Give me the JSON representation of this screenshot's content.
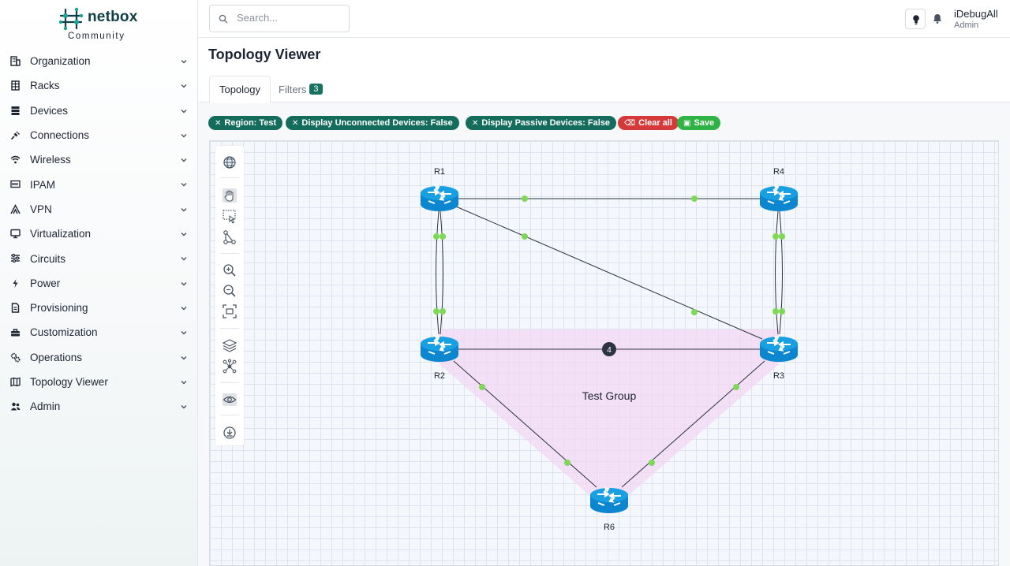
{
  "brand": {
    "name": "netbox",
    "edition": "Community"
  },
  "sidebar": {
    "items": [
      {
        "label": "Organization",
        "icon": "building-icon"
      },
      {
        "label": "Racks",
        "icon": "rack-icon"
      },
      {
        "label": "Devices",
        "icon": "server-icon"
      },
      {
        "label": "Connections",
        "icon": "plug-icon"
      },
      {
        "label": "Wireless",
        "icon": "wifi-icon"
      },
      {
        "label": "IPAM",
        "icon": "counter-icon"
      },
      {
        "label": "VPN",
        "icon": "tunnel-icon"
      },
      {
        "label": "Virtualization",
        "icon": "monitor-icon"
      },
      {
        "label": "Circuits",
        "icon": "circuit-icon"
      },
      {
        "label": "Power",
        "icon": "flash-icon"
      },
      {
        "label": "Provisioning",
        "icon": "file-icon"
      },
      {
        "label": "Customization",
        "icon": "toolbox-icon"
      },
      {
        "label": "Operations",
        "icon": "cogs-icon"
      },
      {
        "label": "Topology Viewer",
        "icon": "map-icon"
      },
      {
        "label": "Admin",
        "icon": "users-icon"
      }
    ]
  },
  "header": {
    "search_placeholder": "Search...",
    "user": {
      "name": "iDebugAll",
      "role": "Admin"
    }
  },
  "page": {
    "title": "Topology Viewer",
    "tabs": [
      {
        "label": "Topology",
        "active": true
      },
      {
        "label": "Filters",
        "count": "3"
      }
    ]
  },
  "filters": {
    "chips": [
      {
        "label": "Region: Test",
        "kind": "filter"
      },
      {
        "label": "Display Unconnected Devices: False",
        "kind": "filter"
      },
      {
        "label": "Display Passive Devices: False",
        "kind": "filter"
      },
      {
        "label": "Clear all",
        "kind": "clear"
      },
      {
        "label": "Save",
        "kind": "save"
      }
    ]
  },
  "topology": {
    "group": {
      "label": "Test Group",
      "color": "#f0d8f2"
    },
    "nodes": [
      {
        "id": "R1",
        "label": "R1"
      },
      {
        "id": "R4",
        "label": "R4"
      },
      {
        "id": "R2",
        "label": "R2"
      },
      {
        "id": "R3",
        "label": "R3"
      },
      {
        "id": "R6",
        "label": "R6"
      }
    ],
    "links": [
      {
        "a": "R1",
        "b": "R4",
        "cables": 1
      },
      {
        "a": "R1",
        "b": "R3",
        "cables": 1
      },
      {
        "a": "R1",
        "b": "R2",
        "cables": 2
      },
      {
        "a": "R4",
        "b": "R3",
        "cables": 2
      },
      {
        "a": "R2",
        "b": "R3",
        "cables": 4,
        "badge": "4"
      },
      {
        "a": "R2",
        "b": "R6",
        "cables": 1
      },
      {
        "a": "R3",
        "b": "R6",
        "cables": 1
      }
    ],
    "colors": {
      "router": "#0f8fd6",
      "endpoint": "#7ed957",
      "badge": "#2c3440"
    }
  },
  "toolbar_tools": [
    "globe-icon",
    "pan-hand-icon",
    "select-box-icon",
    "edges-icon",
    "zoom-in-icon",
    "zoom-out-icon",
    "fit-screen-icon",
    "layers-icon",
    "node-graph-icon",
    "eye-icon",
    "download-icon"
  ]
}
